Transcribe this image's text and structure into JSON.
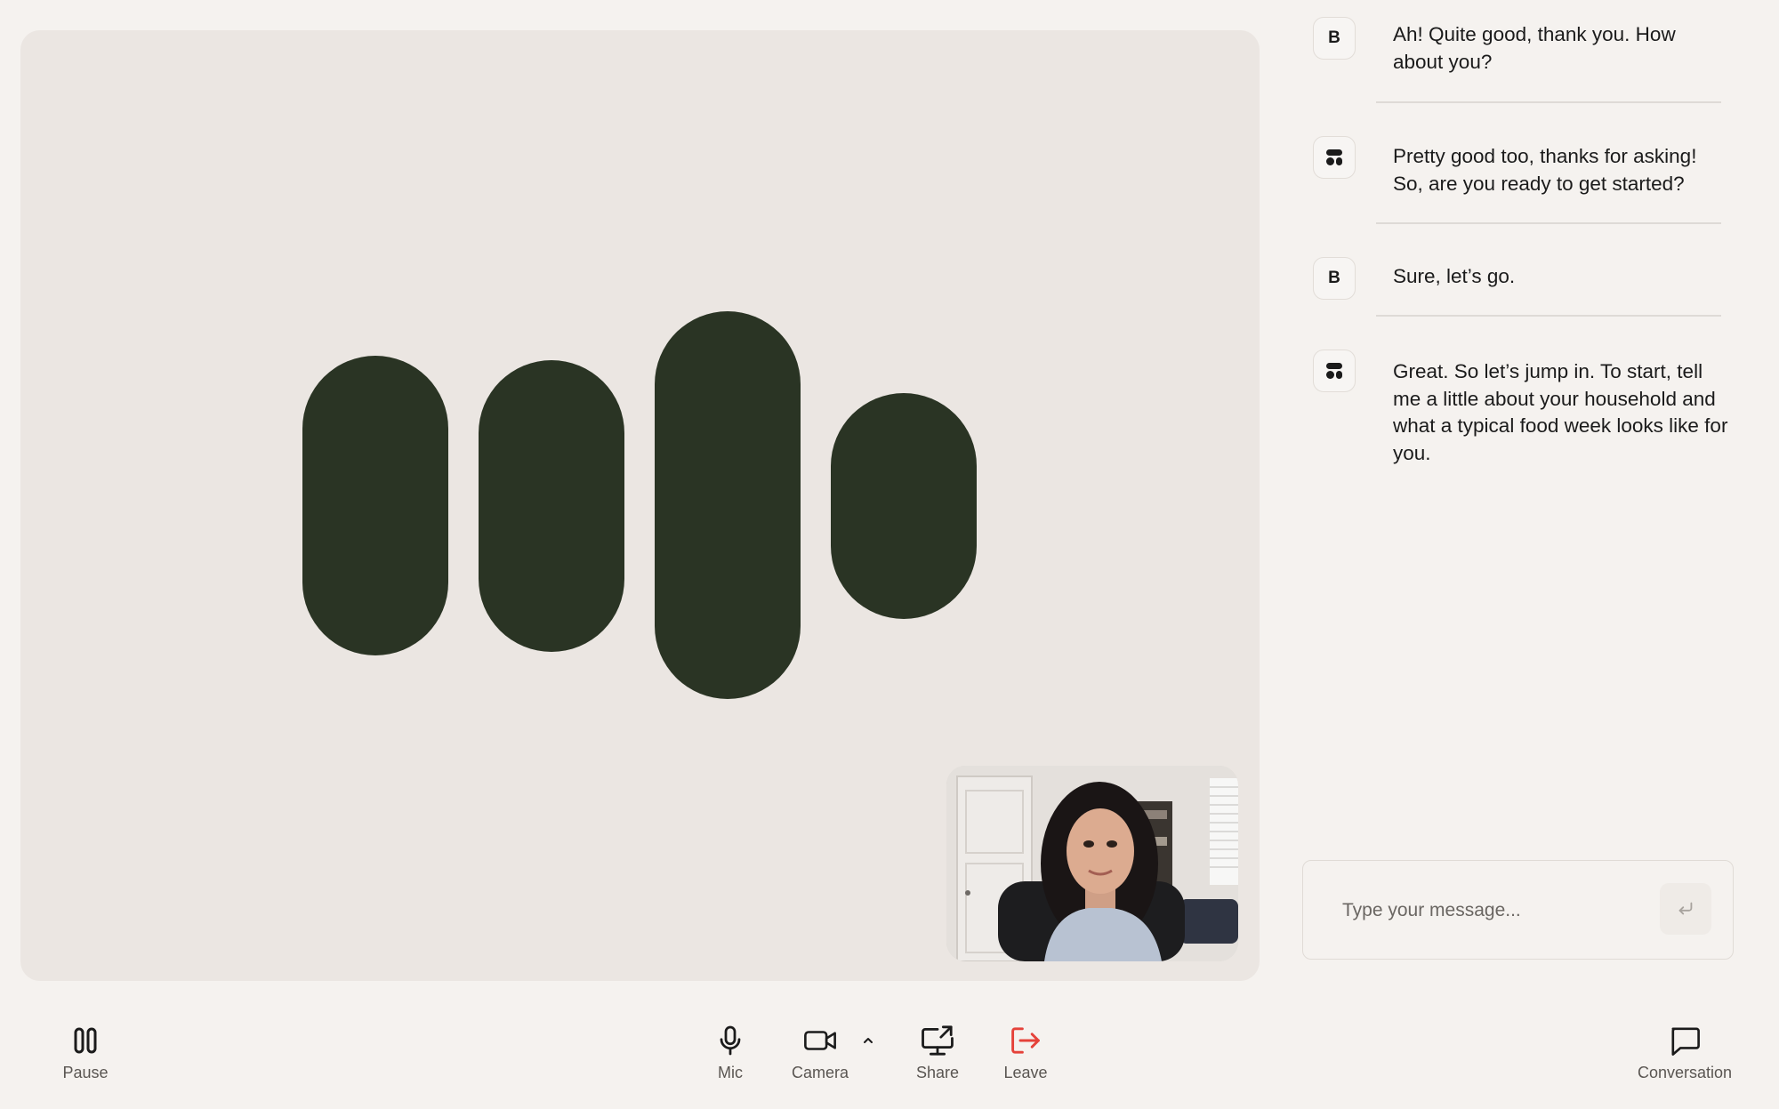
{
  "stage": {
    "visualizer": {
      "bar_color": "#2a3424",
      "bar_count": 4
    },
    "self_view": {
      "kind": "camera-preview"
    }
  },
  "conversation": {
    "messages": [
      {
        "sender": "user",
        "avatar_label": "B",
        "text": "Ah! Quite good, thank you. How about you?"
      },
      {
        "sender": "assistant",
        "avatar_icon": "brand-logo-icon",
        "text": "Pretty good too, thanks for asking! So, are you ready to get started?"
      },
      {
        "sender": "user",
        "avatar_label": "B",
        "text": "Sure, let’s go."
      },
      {
        "sender": "assistant",
        "avatar_icon": "brand-logo-icon",
        "text": "Great. So let’s jump in. To start, tell me a little about your household and what a typical food week looks like for you."
      }
    ],
    "composer": {
      "placeholder": "Type your message..."
    }
  },
  "toolbar": {
    "pause": {
      "label": "Pause",
      "icon": "pause-icon"
    },
    "mic": {
      "label": "Mic",
      "icon": "microphone-icon"
    },
    "camera": {
      "label": "Camera",
      "icon": "video-camera-icon"
    },
    "share": {
      "label": "Share",
      "icon": "screen-share-icon"
    },
    "leave": {
      "label": "Leave",
      "icon": "leave-icon",
      "color": "#e5423a"
    },
    "conversation": {
      "label": "Conversation",
      "icon": "chat-bubble-icon"
    }
  }
}
